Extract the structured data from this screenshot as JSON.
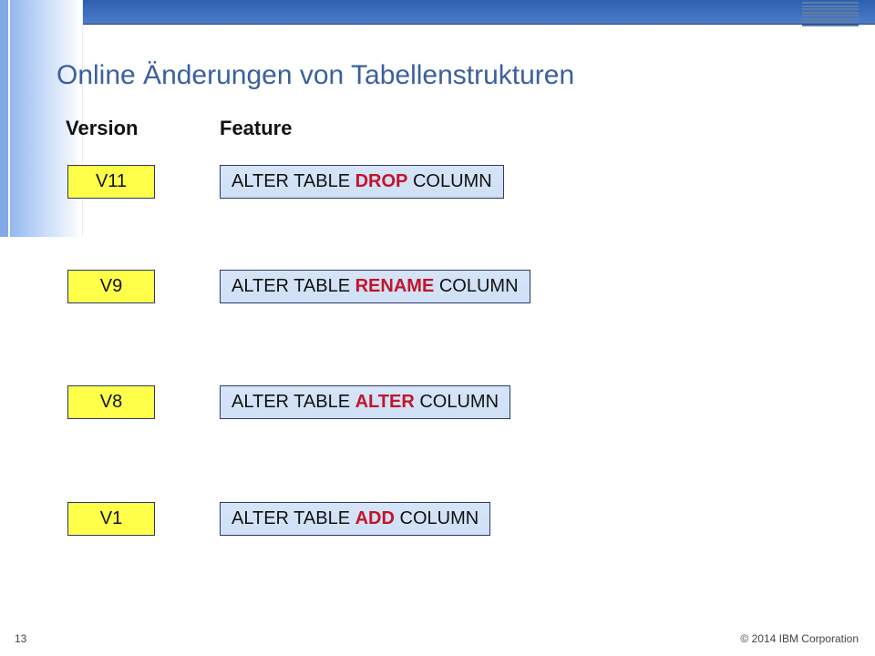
{
  "title": "Online Änderungen von Tabellenstrukturen",
  "headers": {
    "version": "Version",
    "feature": "Feature"
  },
  "rows": [
    {
      "version": "V11",
      "feature_pre": "ALTER TABLE ",
      "feature_hot": "DROP",
      "feature_post": " COLUMN"
    },
    {
      "version": "V9",
      "feature_pre": "ALTER TABLE ",
      "feature_hot": "RENAME",
      "feature_post": " COLUMN"
    },
    {
      "version": "V8",
      "feature_pre": "ALTER TABLE ",
      "feature_hot": "ALTER",
      "feature_post": " COLUMN"
    },
    {
      "version": "V1",
      "feature_pre": "ALTER TABLE ",
      "feature_hot": "ADD",
      "feature_post": " COLUMN"
    }
  ],
  "footer": {
    "page": "13",
    "copyright": "© 2014 IBM Corporation"
  },
  "brand": "IBM"
}
